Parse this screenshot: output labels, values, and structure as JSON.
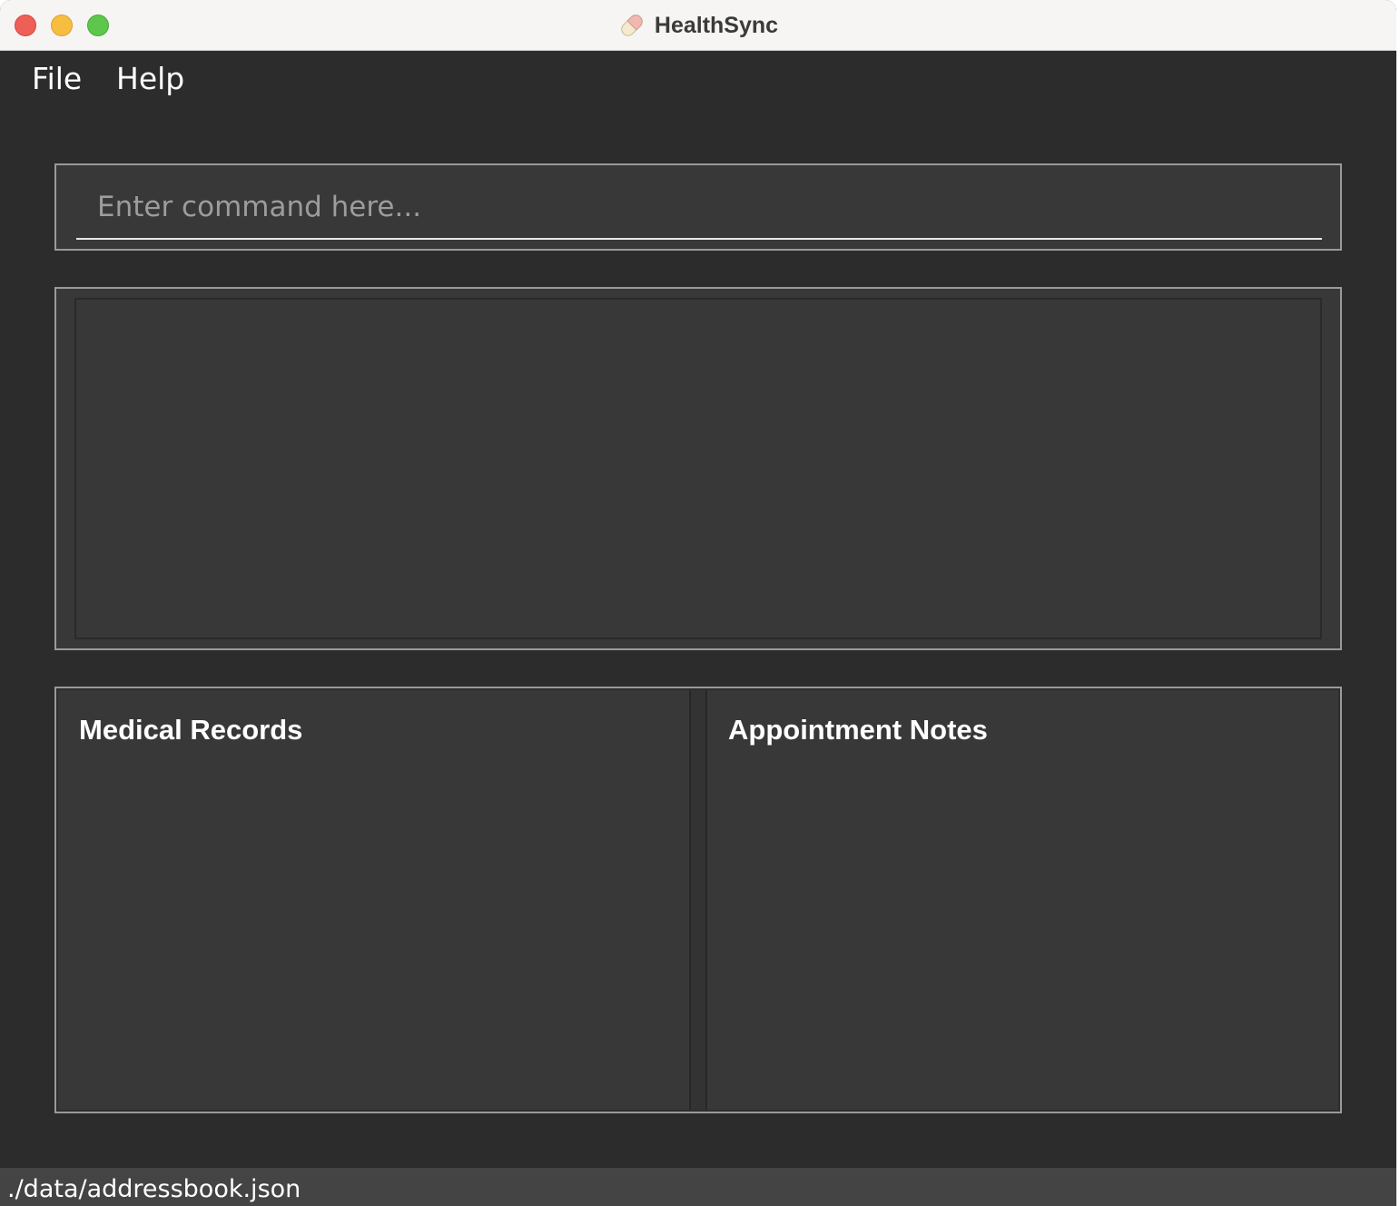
{
  "window": {
    "title": "HealthSync",
    "app_icon": "pill-icon",
    "traffic_lights": {
      "close_color": "#ee5f57",
      "minimize_color": "#f6bd3f",
      "maximize_color": "#5fc64c"
    }
  },
  "menu": {
    "items": [
      {
        "label": "File"
      },
      {
        "label": "Help"
      }
    ]
  },
  "command": {
    "value": "",
    "placeholder": "Enter command here..."
  },
  "result_display": {
    "text": ""
  },
  "panels": {
    "medical_records": {
      "title": "Medical Records"
    },
    "appointment_notes": {
      "title": "Appointment Notes"
    }
  },
  "status": {
    "file_path": "./data/addressbook.json"
  },
  "colors": {
    "background": "#2c2c2c",
    "panel": "#383838",
    "border": "#9a9a9a",
    "status_bar": "#444444"
  }
}
